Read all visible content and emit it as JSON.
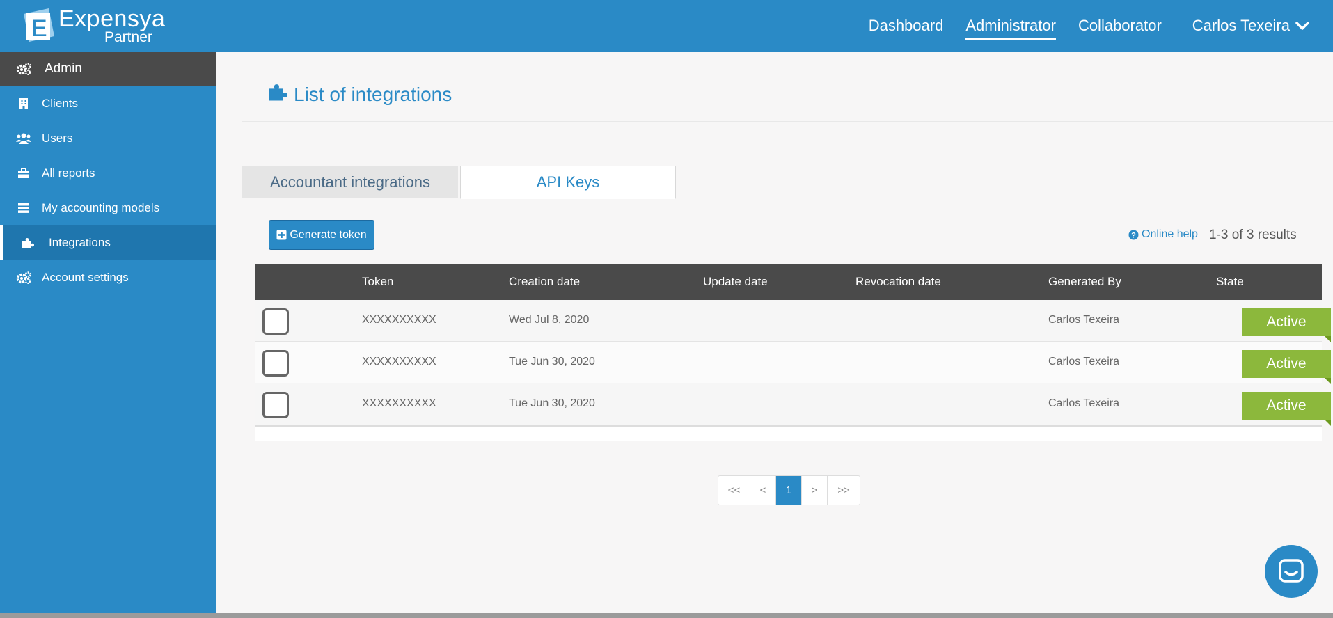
{
  "brand": {
    "name": "Expensya",
    "sub": "Partner"
  },
  "topnav": {
    "items": [
      {
        "label": "Dashboard",
        "active": false
      },
      {
        "label": "Administrator",
        "active": true
      },
      {
        "label": "Collaborator",
        "active": false
      }
    ],
    "user": "Carlos Texeira"
  },
  "sidebar": {
    "items": [
      {
        "label": "Admin",
        "icon": "gears-icon"
      },
      {
        "label": "Clients",
        "icon": "building-icon"
      },
      {
        "label": "Users",
        "icon": "users-icon"
      },
      {
        "label": "All reports",
        "icon": "briefcase-icon"
      },
      {
        "label": "My accounting models",
        "icon": "list-icon"
      },
      {
        "label": "Integrations",
        "icon": "puzzle-icon",
        "active": true
      },
      {
        "label": "Account settings",
        "icon": "gears-icon"
      }
    ]
  },
  "page": {
    "title": "List of integrations"
  },
  "tabs": [
    {
      "label": "Accountant integrations",
      "selected": false
    },
    {
      "label": "API Keys",
      "selected": true
    }
  ],
  "toolbar": {
    "generate_label": "Generate token",
    "help_label": "Online help",
    "count": "1-3 of 3 results"
  },
  "table": {
    "headers": {
      "token": "Token",
      "creation": "Creation date",
      "update": "Update date",
      "revocation": "Revocation date",
      "generated_by": "Generated By",
      "state": "State"
    },
    "rows": [
      {
        "token": "XXXXXXXXXX",
        "creation": "Wed Jul 8, 2020",
        "update": "",
        "revocation": "",
        "generated_by": "Carlos Texeira",
        "state": "Active"
      },
      {
        "token": "XXXXXXXXXX",
        "creation": "Tue Jun 30, 2020",
        "update": "",
        "revocation": "",
        "generated_by": "Carlos Texeira",
        "state": "Active"
      },
      {
        "token": "XXXXXXXXXX",
        "creation": "Tue Jun 30, 2020",
        "update": "",
        "revocation": "",
        "generated_by": "Carlos Texeira",
        "state": "Active"
      }
    ]
  },
  "pager": {
    "first": "<<",
    "prev": "<",
    "current": "1",
    "next": ">",
    "last": ">>"
  },
  "colors": {
    "primary": "#2a8ac6",
    "dark": "#4a4a4a",
    "active_badge": "#8cb83c"
  }
}
